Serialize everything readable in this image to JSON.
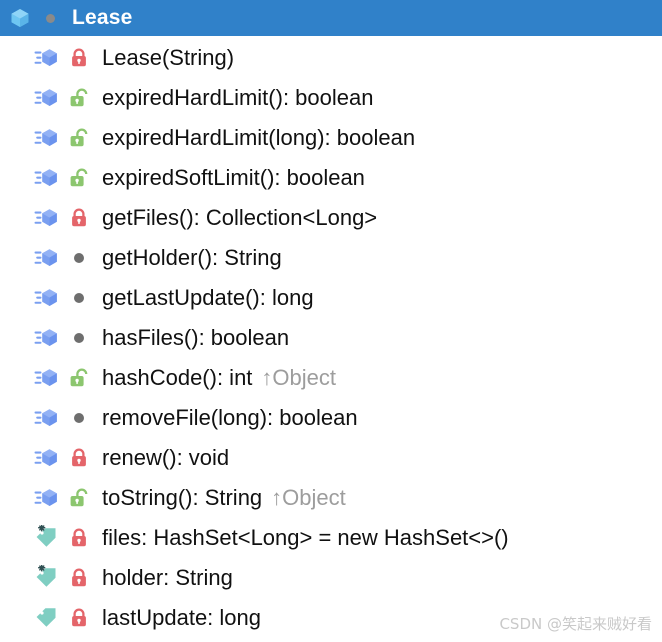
{
  "header": {
    "title": "Lease",
    "class_icon": "class-cube-icon",
    "visibility_icon": "package-private-dot-icon",
    "background_color": "#3081c9",
    "title_color": "#ffffff"
  },
  "colors": {
    "method_icon": "#7a9ff0",
    "field_icon": "#7fcec2",
    "lock_private": "#e4656a",
    "lock_public": "#8cc66f",
    "dot_package": "#6e6e6e",
    "override_text": "#9d9d9d",
    "text": "#111111"
  },
  "members": [
    {
      "kind": "method",
      "kind_icon": "method-icon",
      "access": "private",
      "access_icon": "lock-closed-icon",
      "label": "Lease(String)",
      "override": ""
    },
    {
      "kind": "method",
      "kind_icon": "method-icon",
      "access": "public",
      "access_icon": "lock-open-icon",
      "label": "expiredHardLimit(): boolean",
      "override": ""
    },
    {
      "kind": "method",
      "kind_icon": "method-icon",
      "access": "public",
      "access_icon": "lock-open-icon",
      "label": "expiredHardLimit(long): boolean",
      "override": ""
    },
    {
      "kind": "method",
      "kind_icon": "method-icon",
      "access": "public",
      "access_icon": "lock-open-icon",
      "label": "expiredSoftLimit(): boolean",
      "override": ""
    },
    {
      "kind": "method",
      "kind_icon": "method-icon",
      "access": "private",
      "access_icon": "lock-closed-icon",
      "label": "getFiles(): Collection<Long>",
      "override": ""
    },
    {
      "kind": "method",
      "kind_icon": "method-icon",
      "access": "package",
      "access_icon": "dot-icon",
      "label": "getHolder(): String",
      "override": ""
    },
    {
      "kind": "method",
      "kind_icon": "method-icon",
      "access": "package",
      "access_icon": "dot-icon",
      "label": "getLastUpdate(): long",
      "override": ""
    },
    {
      "kind": "method",
      "kind_icon": "method-icon",
      "access": "package",
      "access_icon": "dot-icon",
      "label": "hasFiles(): boolean",
      "override": ""
    },
    {
      "kind": "method",
      "kind_icon": "method-icon",
      "access": "public",
      "access_icon": "lock-open-icon",
      "label": "hashCode(): int",
      "override": "↑Object"
    },
    {
      "kind": "method",
      "kind_icon": "method-icon",
      "access": "package",
      "access_icon": "dot-icon",
      "label": "removeFile(long): boolean",
      "override": ""
    },
    {
      "kind": "method",
      "kind_icon": "method-icon",
      "access": "private",
      "access_icon": "lock-closed-icon",
      "label": "renew(): void",
      "override": ""
    },
    {
      "kind": "method",
      "kind_icon": "method-icon",
      "access": "public",
      "access_icon": "lock-open-icon",
      "label": "toString(): String",
      "override": "↑Object"
    },
    {
      "kind": "field-final",
      "kind_icon": "field-final-icon",
      "access": "private",
      "access_icon": "lock-closed-icon",
      "label": "files: HashSet<Long> = new HashSet<>()",
      "override": ""
    },
    {
      "kind": "field-final",
      "kind_icon": "field-final-icon",
      "access": "private",
      "access_icon": "lock-closed-icon",
      "label": "holder: String",
      "override": ""
    },
    {
      "kind": "field",
      "kind_icon": "field-icon",
      "access": "private",
      "access_icon": "lock-closed-icon",
      "label": "lastUpdate: long",
      "override": ""
    }
  ],
  "watermark": {
    "text": "CSDN @笑起来贼好看"
  }
}
